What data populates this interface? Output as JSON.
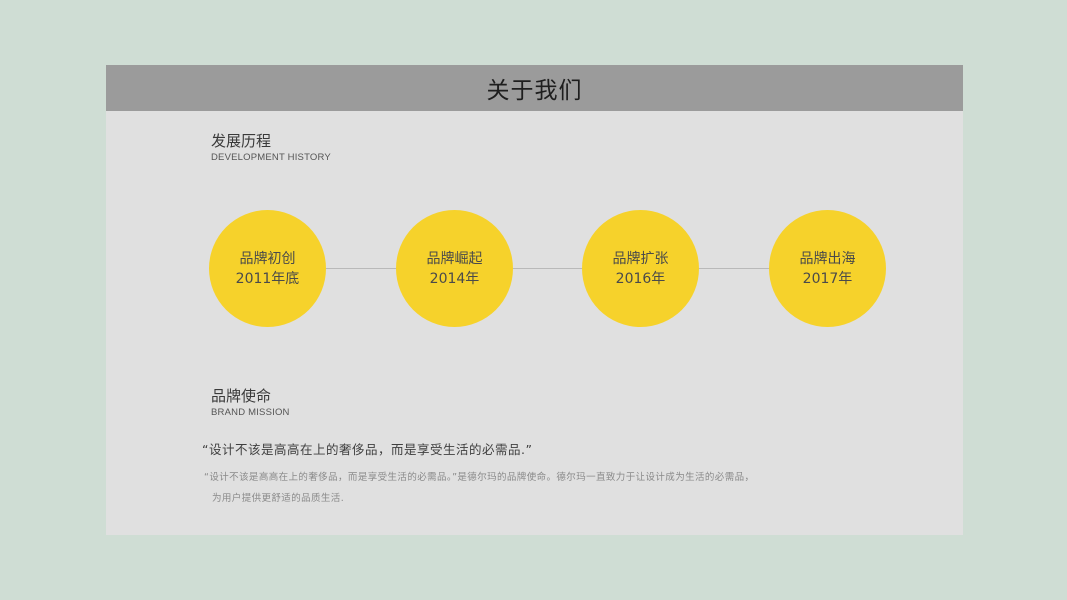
{
  "header": {
    "title": "关于我们"
  },
  "history": {
    "title": "发展历程",
    "subtitle": "DEVELOPMENT HISTORY",
    "milestones": [
      {
        "label": "品牌初创",
        "year": "2011年底"
      },
      {
        "label": "品牌崛起",
        "year": "2014年"
      },
      {
        "label": "品牌扩张",
        "year": "2016年"
      },
      {
        "label": "品牌出海",
        "year": "2017年"
      }
    ]
  },
  "mission": {
    "title": "品牌使命",
    "subtitle": "BRAND MISSION",
    "quote": "“设计不该是高高在上的奢侈品，而是享受生活的必需品.”",
    "description_line1": "“设计不该是高高在上的奢侈品，而是享受生活的必需品。”是德尔玛的品牌使命。德尔玛一直致力于让设计成为生活的必需品，",
    "description_line2": "为用户提供更舒适的品质生活."
  },
  "colors": {
    "page_background": "#cfddd4",
    "slide_background": "#e0e0e0",
    "title_bar": "#9b9b9b",
    "circle_fill": "#f6d22b"
  }
}
